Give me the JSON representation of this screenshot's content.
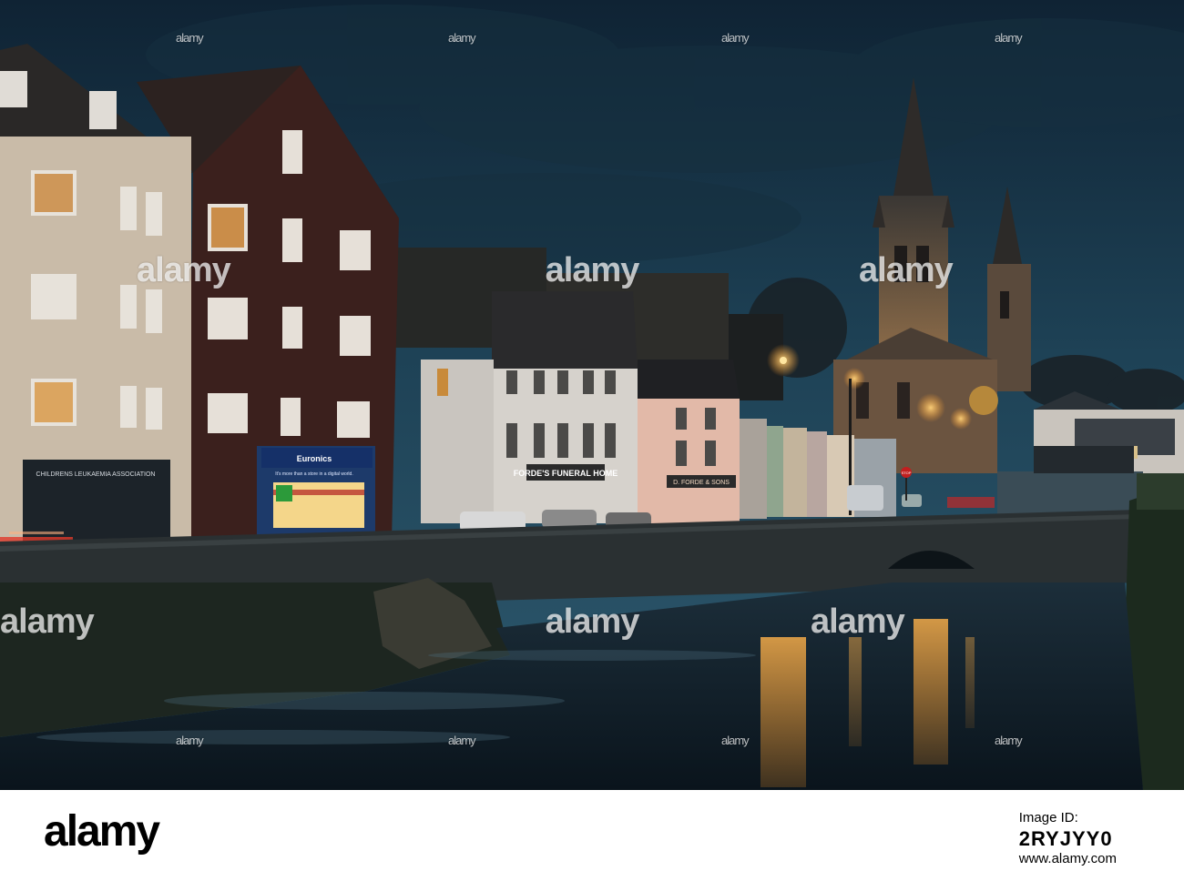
{
  "scene": {
    "signs": {
      "shop_name": "Euronics",
      "shop_tagline": "It's more than a store in a digital world.",
      "leukaemia": "CHILDRENS LEUKAEMIA ASSOCIATION",
      "fordes": "FORDE'S FUNERAL HOME",
      "forde_sons": "D. FORDE & SONS",
      "stop": "STOP"
    }
  },
  "watermark": {
    "text": "alamy"
  },
  "footer": {
    "logo": "alamy",
    "id_label": "Image ID:",
    "id_value": "2RYJYY0",
    "site": "www.alamy.com"
  },
  "colors": {
    "sky_top": "#0f2436",
    "sky_mid": "#1e4458",
    "sky_low": "#2f5c72",
    "water": "#0d1a24",
    "wall": "#262d2f",
    "lamp": "#ffb347",
    "brick": "#3a1f1c"
  }
}
